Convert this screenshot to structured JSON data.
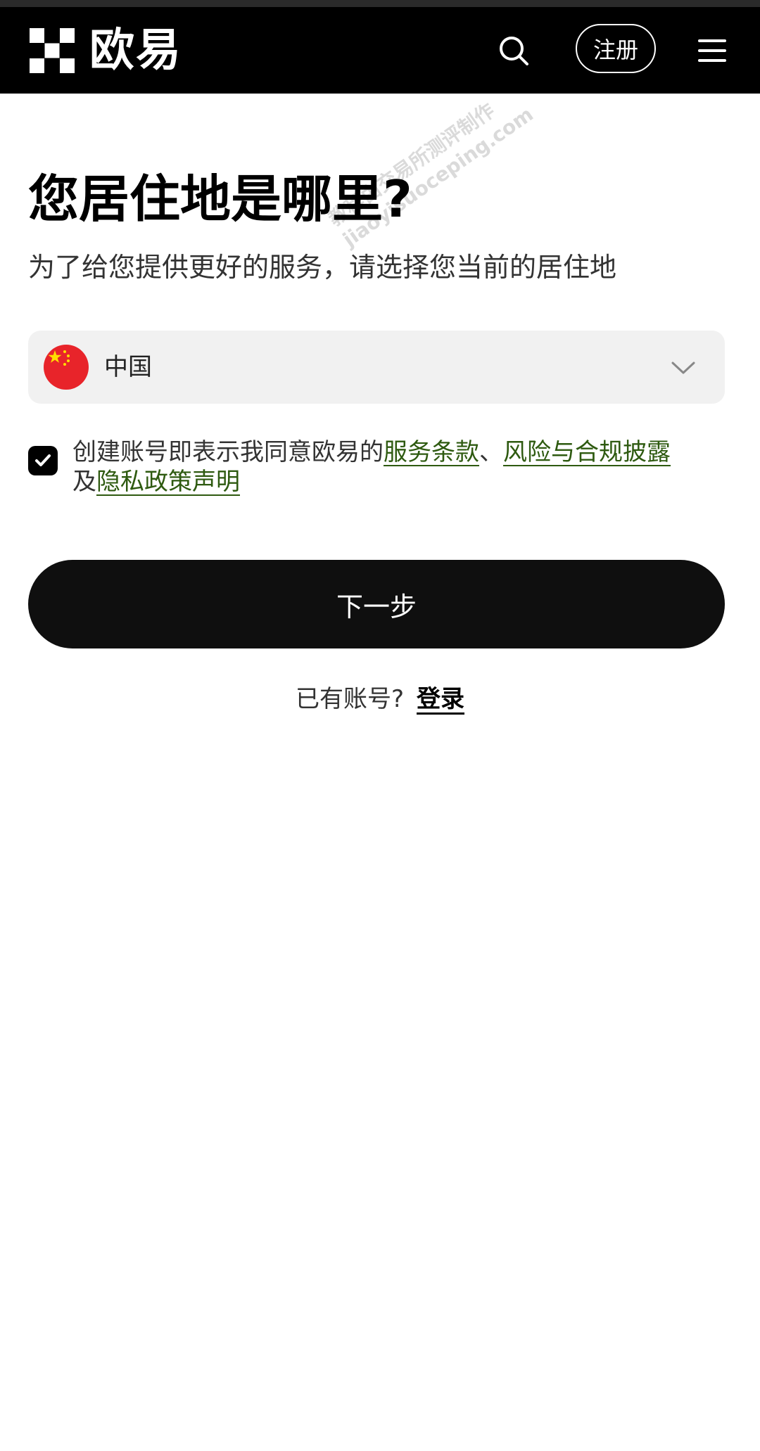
{
  "header": {
    "logo_text": "欧易",
    "register_label": "注册",
    "search_icon": "search-icon",
    "menu_icon": "hamburger-menu-icon"
  },
  "watermark": {
    "line1": "教程由交易所测评制作",
    "line2": "jiaoyisuoceping.com"
  },
  "main": {
    "title": "您居住地是哪里?",
    "subtitle": "为了给您提供更好的服务，请选择您当前的居住地",
    "region": {
      "selected": "中国",
      "flag_icon": "china-flag-icon"
    },
    "agreement": {
      "checked": true,
      "prefix": "创建账号即表示我同意欧易的",
      "link_terms": "服务条款",
      "sep1": "、",
      "link_risk": "风险与合规披露",
      "and": "及",
      "link_privacy": "隐私政策声明"
    },
    "next_label": "下一步",
    "login": {
      "prompt": "已有账号?",
      "link": "登录"
    }
  },
  "colors": {
    "header_bg": "#000000",
    "link_green": "#2e5a10",
    "button_bg": "#0f0f0f",
    "select_bg": "#f1f1f1"
  }
}
